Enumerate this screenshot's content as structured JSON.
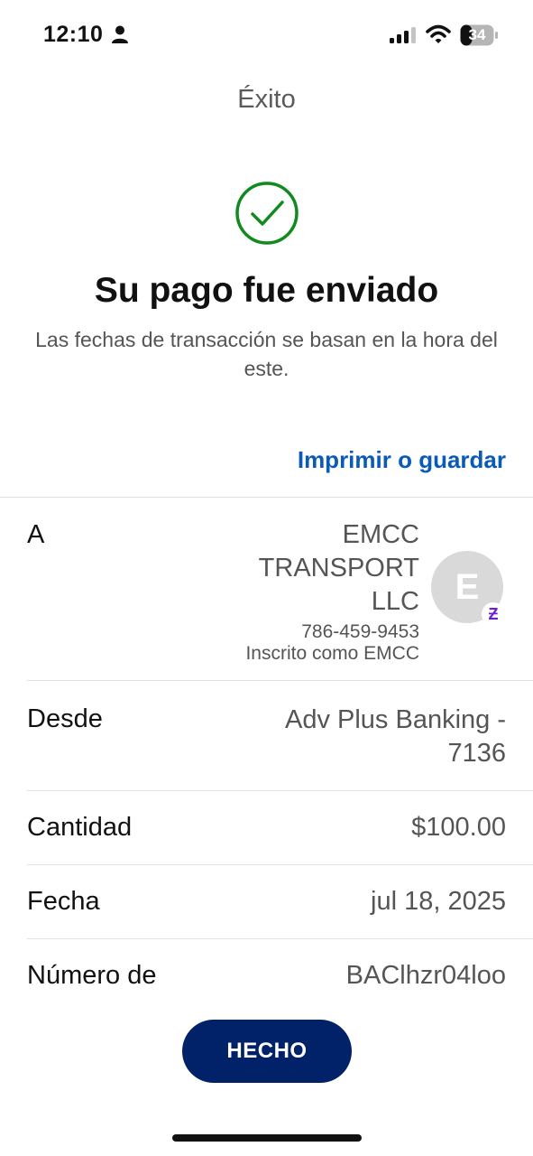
{
  "status_bar": {
    "time": "12:10",
    "battery": "34",
    "icons": [
      "person-icon",
      "signal-icon",
      "wifi-icon",
      "battery-icon"
    ]
  },
  "nav": {
    "title": "Éxito"
  },
  "success": {
    "icon": "check-circle-icon",
    "icon_color": "#118a1f",
    "headline": "Su pago fue enviado",
    "subtitle": "Las fechas de transacción se basan en la hora del este."
  },
  "actions": {
    "print_label": "Imprimir o guardar",
    "link_color": "#0a5bb8"
  },
  "details": {
    "to": {
      "label": "A",
      "name": "EMCC TRANSPORT LLC",
      "phone": "786-459-9453",
      "enrolled": "Inscrito como EMCC",
      "avatar_initial": "E",
      "badge_glyph": "Ƶ",
      "badge_color": "#6d1ed4"
    },
    "from": {
      "label": "Desde",
      "value": "Adv Plus Banking - 7136"
    },
    "amount": {
      "label": "Cantidad",
      "value": "$100.00"
    },
    "date": {
      "label": "Fecha",
      "value": "jul 18, 2025"
    },
    "number": {
      "label": "Número de",
      "value": "BAClhzr04loo"
    }
  },
  "footer": {
    "done_label": "HECHO",
    "button_color": "#012169"
  }
}
